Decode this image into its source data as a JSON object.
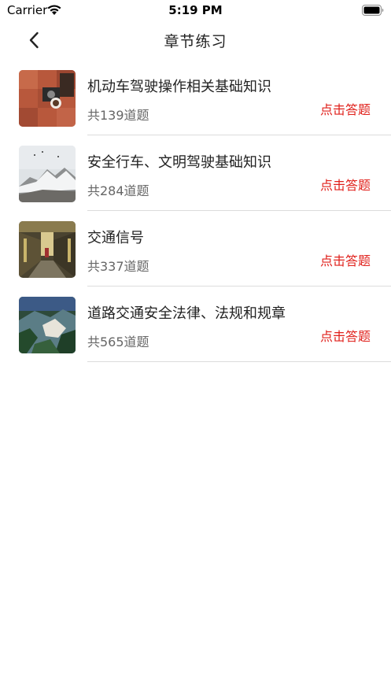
{
  "status_bar": {
    "carrier": "Carrier",
    "time": "5:19 PM"
  },
  "nav": {
    "title": "章节练习"
  },
  "chapters": [
    {
      "title": "机动车驾驶操作相关基础知识",
      "count": "共139道题",
      "action": "点击答题"
    },
    {
      "title": "安全行车、文明驾驶基础知识",
      "count": "共284道题",
      "action": "点击答题"
    },
    {
      "title": "交通信号",
      "count": "共337道题",
      "action": "点击答题"
    },
    {
      "title": "道路交通安全法律、法规和规章",
      "count": "共565道题",
      "action": "点击答题"
    }
  ],
  "colors": {
    "accent": "#e0201b",
    "divider": "#dcdcdc"
  }
}
